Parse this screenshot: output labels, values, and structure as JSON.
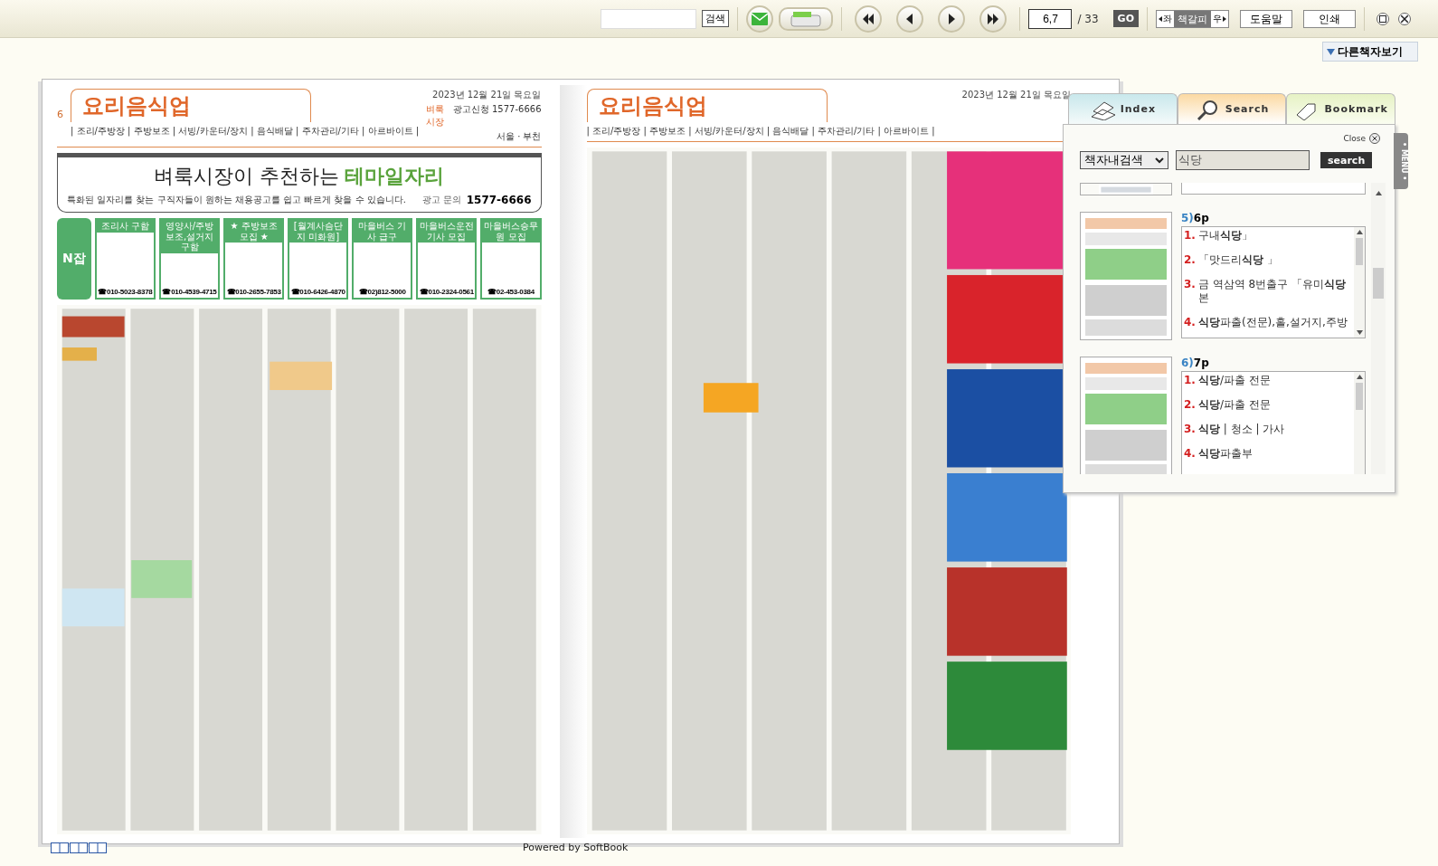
{
  "toolbar": {
    "search_button": "검색",
    "page_input": "6,7",
    "page_total": "/ 33",
    "go_button": "GO",
    "bookmark_left": "좌",
    "bookmark_label": "책갈피",
    "bookmark_right": "우",
    "help_button": "도움말",
    "print_button": "인쇄"
  },
  "other_books": "다른책자보기",
  "left_page": {
    "page_number": "6",
    "section_title": "요리음식업",
    "date": "2023년 12월 21일 목요일",
    "publisher": "벼룩시장",
    "ad_phone": "광고신청 1577-6666",
    "region": "서울 · 부천",
    "categories": "| 조리/주방장 | 주방보조 | 서빙/카운터/장치 | 음식배달 | 주차관리/기타 | 아르바이트 |",
    "banner_title": "벼룩시장이 추천하는",
    "banner_highlight": "테마일자리",
    "banner_subtitle": "특화된 일자리를 찾는 구직자들이 원하는 채용공고를 쉽고 빠르게 찾을 수 있습니다.",
    "banner_contact_label": "광고 문의",
    "banner_phone": "1577-6666",
    "njob_label": "N잡",
    "ads": [
      {
        "title": "조리사 구함",
        "phone": "☎010-5023-8378"
      },
      {
        "title": "영양사/주방보조,설거지 구함",
        "phone": "☎010-4539-4715"
      },
      {
        "title": "★ 주방보조모집 ★",
        "phone": "☎010-2655-7853"
      },
      {
        "title": "[월계사슴단지 미화원]",
        "phone": "☎010-6426-4870"
      },
      {
        "title": "마을버스 기사 급구",
        "phone": "☎02)812-5000"
      },
      {
        "title": "마을버스운전기사 모집",
        "phone": "☎010-2324-0561"
      },
      {
        "title": "마을버스승무원 모집",
        "phone": "☎02-453-0384"
      }
    ]
  },
  "right_page": {
    "section_title": "요리음식업",
    "date": "2023년 12월 21일 목요일",
    "categories": "| 조리/주방장 | 주방보조 | 서빙/카운터/장치 | 음식배달 | 주차관리/기타 | 아르바이트 |"
  },
  "panel": {
    "tabs": [
      {
        "label": "Index",
        "selected": false
      },
      {
        "label": "Search",
        "selected": true
      },
      {
        "label": "Bookmark",
        "selected": false
      }
    ],
    "close": "Close",
    "scope": "책자내검색",
    "query": "식당",
    "search_button": "search",
    "menu_tab": "• MENU •",
    "results": [
      {
        "index": "5)",
        "page": "6p",
        "items": [
          {
            "num": "1.",
            "text": "구내**식당**」"
          },
          {
            "num": "2.",
            "text": "「맛드리**식당** 」"
          },
          {
            "num": "3.",
            "text": "금 역삼역 8번출구 「유미**식당** 본"
          },
          {
            "num": "4.",
            "text": "**식당**파출(전문),홀,설거지,주방"
          }
        ]
      },
      {
        "index": "6)",
        "page": "7p",
        "items": [
          {
            "num": "1.",
            "text": "**식당**/파출 전문"
          },
          {
            "num": "2.",
            "text": "**식당**/파출 전문"
          },
          {
            "num": "3.",
            "text": "**식당** | 청소 | 가사"
          },
          {
            "num": "4.",
            "text": "**식당**파출부"
          }
        ]
      }
    ]
  },
  "footer": "Powered by SoftBook"
}
